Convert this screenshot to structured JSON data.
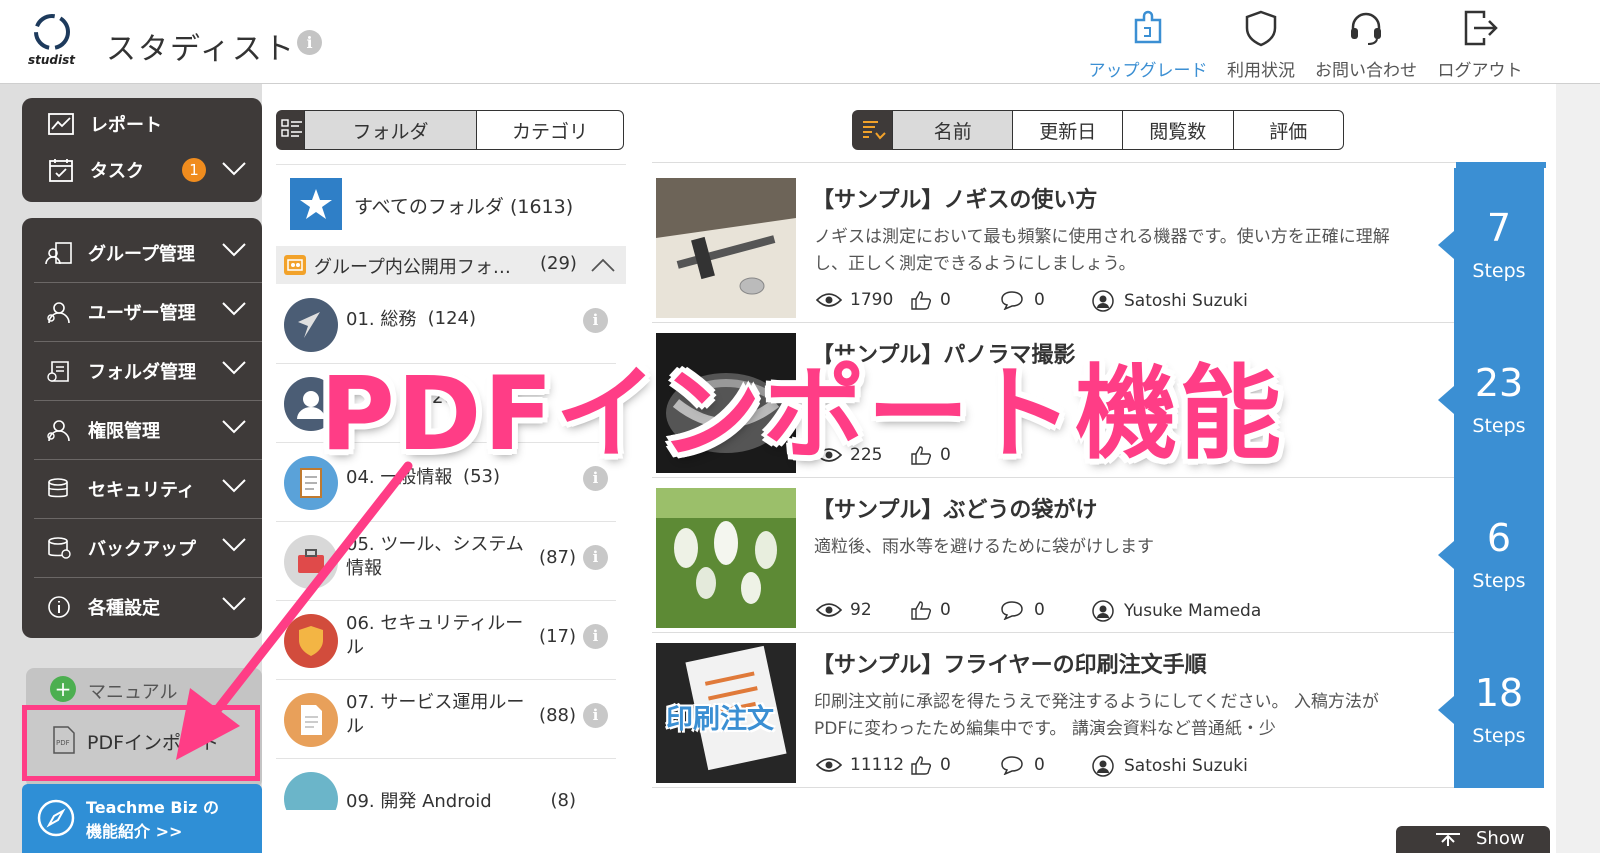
{
  "header": {
    "logo_text": "studist",
    "app_title": "スタディスト",
    "info_glyph": "i",
    "nav": [
      {
        "label": "アップグレード",
        "icon": "puzzle-icon",
        "color": "#3b8fd3"
      },
      {
        "label": "利用状況",
        "icon": "shield-icon"
      },
      {
        "label": "お問い合わせ",
        "icon": "headset-icon"
      },
      {
        "label": "ログアウト",
        "icon": "logout-icon"
      }
    ]
  },
  "sidebar": {
    "top_items": [
      {
        "label": "レポート",
        "icon": "chart-icon"
      },
      {
        "label": "タスク",
        "icon": "calendar-icon",
        "badge": "1"
      }
    ],
    "admin_items": [
      {
        "label": "グループ管理",
        "icon": "group-icon"
      },
      {
        "label": "ユーザー管理",
        "icon": "users-gear-icon"
      },
      {
        "label": "フォルダ管理",
        "icon": "folder-gear-icon"
      },
      {
        "label": "権限管理",
        "icon": "permission-icon"
      },
      {
        "label": "セキュリティ",
        "icon": "security-icon"
      },
      {
        "label": "バックアップ",
        "icon": "backup-icon"
      },
      {
        "label": "各種設定",
        "icon": "settings-info-icon"
      }
    ],
    "bottom_items": [
      {
        "label": "マニュアル",
        "icon": "plus-icon"
      },
      {
        "label": "PDFインポート",
        "icon": "pdf-file-icon"
      }
    ],
    "promo_line1": "Teachme Biz の",
    "promo_line2": "機能紹介 >>"
  },
  "folder_view": {
    "tabs": [
      "フォルダ",
      "カテゴリ"
    ],
    "active_tab": "フォルダ",
    "all_folders": "すべてのフォルダ (1613)",
    "group_header": {
      "label": "グループ内公開用フォ…",
      "count": "(29)"
    },
    "folders": [
      {
        "name": "01. 総務",
        "count": "(124)"
      },
      {
        "name": "",
        "count": "26"
      },
      {
        "name": "04. 一般情報",
        "count": "(53)"
      },
      {
        "name": "05. ツール、システム情報",
        "count": "(87)"
      },
      {
        "name": "06. セキュリティルール",
        "count": "(17)"
      },
      {
        "name": "07. サービス運用ルール",
        "count": "(88)"
      },
      {
        "name": "09. 開発 Android",
        "count": "(8)"
      }
    ]
  },
  "sort_bar": {
    "options": [
      "名前",
      "更新日",
      "閲覧数",
      "評価"
    ],
    "active": "名前"
  },
  "manuals": [
    {
      "title": "【サンプル】ノギスの使い方",
      "desc": "ノギスは測定において最も頻繁に使用される機器です。使い方を正確に理解し、正しく測定できるようにしましょう。",
      "views": "1790",
      "likes": "0",
      "comments": "0",
      "author": "Satoshi Suzuki",
      "steps": "7"
    },
    {
      "title": "【サンプル】パノラマ撮影",
      "desc": "",
      "views": "225",
      "likes": "0",
      "comments": "",
      "author": "",
      "steps": "23"
    },
    {
      "title": "【サンプル】ぶどうの袋がけ",
      "desc": "適粒後、雨水等を避けるために袋がけします",
      "views": "92",
      "likes": "0",
      "comments": "0",
      "author": "Yusuke Mameda",
      "steps": "6"
    },
    {
      "title": "【サンプル】フライヤーの印刷注文手順",
      "desc": "印刷注文前に承認を得たうえで発注するようにしてください。 入稿方法がPDFに変わったため編集中です。 講演会資料など普通紙・少",
      "views": "11112",
      "likes": "0",
      "comments": "0",
      "author": "Satoshi Suzuki",
      "steps": "18",
      "thumb_text": "印刷注文"
    }
  ],
  "steps_label": "Steps",
  "show_button": "Show",
  "overlay_text": "PDFインポート機能",
  "colors": {
    "accent_blue": "#3b8fd3",
    "overlay_pink": "#ff3d86",
    "sidebar_dark": "#3e3a39",
    "badge_orange": "#f08c1e"
  }
}
